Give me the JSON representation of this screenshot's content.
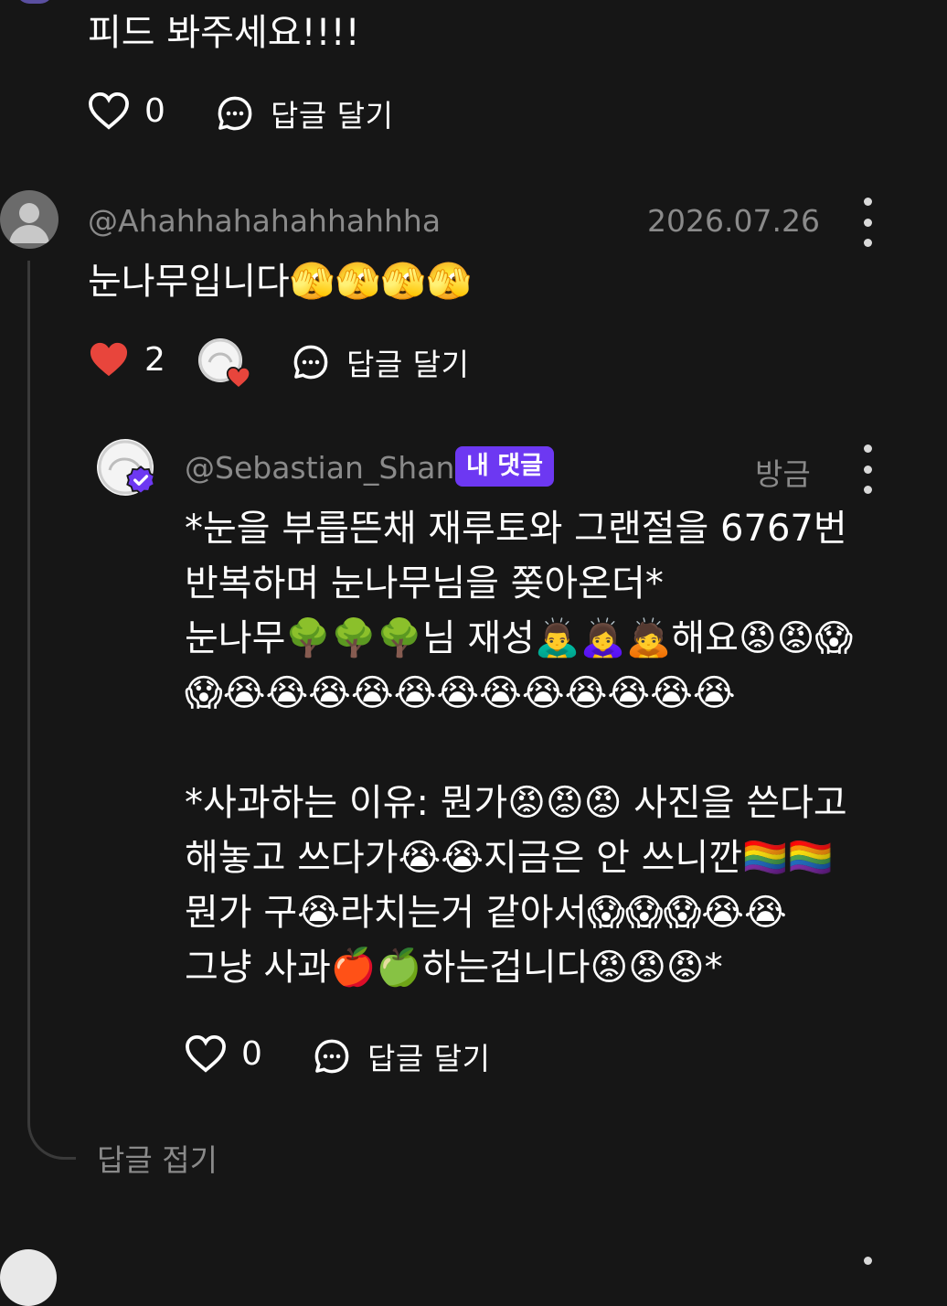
{
  "top_comment": {
    "text_tail": "피드 봐주세요!!!!",
    "likes": "0",
    "reply_label": "답글 달기"
  },
  "comment": {
    "username": "@Ahahhahahahhahhha",
    "date": "2026.07.26",
    "text": "눈나무입니다🫣🫣🫣🫣",
    "likes": "2",
    "reply_label": "답글 달기"
  },
  "reply": {
    "username": "@Sebastian_Shan",
    "badge": "내 댓글",
    "time": "방금",
    "lines": [
      "*눈을 부릅뜬채 재루토와 그랜절을 6767번",
      "반복하며 눈나무님을 쫒아온더*",
      "눈나무🌳🌳🌳님 재성🙇‍♂️🙇‍♀️🙇해요😡😡😱",
      "😱😭😭😭😭😭😭😭😭😭😭😭😭",
      "",
      "*사과하는 이유: 뭔가😡😡😡 사진을 쓴다고",
      "해놓고 쓰다가😭😭지금은 안 쓰니깐🏳️‍🌈🏳️‍🌈",
      "뭔가 구😭라치는거 같아서😱😱😱😭😭",
      "그냥 사과🍎🍏하는겁니다😡😡😡*"
    ],
    "likes": "0",
    "reply_label": "답글 달기"
  },
  "collapse_label": "답글 접기",
  "colors": {
    "background": "#161616",
    "badge": "#6d38f2",
    "heart_liked": "#e8453c",
    "muted_text": "#8a8a8a"
  },
  "icons": [
    "heart-outline-icon",
    "heart-filled-icon",
    "speech-bubble-icon",
    "more-vertical-icon",
    "verified-badge-icon",
    "person-icon"
  ]
}
